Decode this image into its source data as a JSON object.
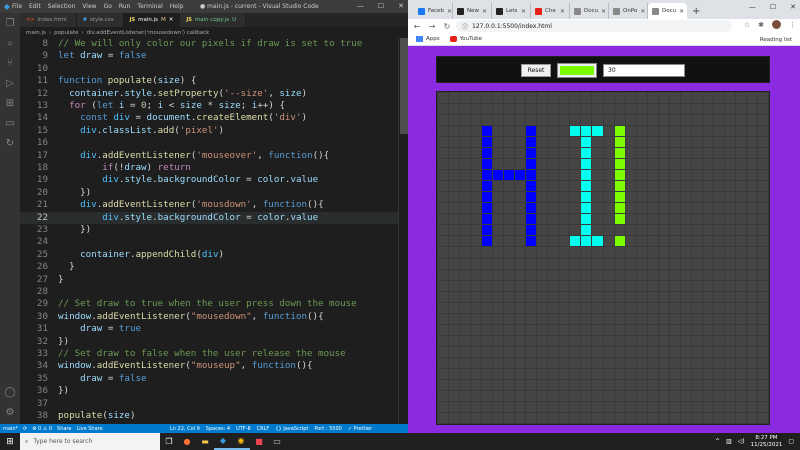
{
  "vscode": {
    "menu": [
      "File",
      "Edit",
      "Selection",
      "View",
      "Go",
      "Run",
      "Terminal",
      "Help"
    ],
    "window_title": "● main.js - current - Visual Studio Code",
    "tabs": [
      {
        "label": "index.html",
        "icon": "<>",
        "color": "#e44d26",
        "active": false,
        "badge": ""
      },
      {
        "label": "style.css",
        "icon": "#",
        "color": "#42a5f5",
        "active": false,
        "badge": ""
      },
      {
        "label": "main.js",
        "icon": "JS",
        "color": "#f1e05a",
        "active": true,
        "badge": "M"
      },
      {
        "label": "main copy.js",
        "icon": "JS",
        "color": "#f1e05a",
        "active": false,
        "badge": "U"
      }
    ],
    "breadcrumb": [
      "main.js",
      "populate",
      "div.addEventListener('mousedown') callback"
    ],
    "current_line": 22,
    "status": {
      "branch": "main*",
      "sync": "⟳",
      "problems": "⊗ 0 ⚠ 0",
      "share": "Share",
      "live_share": "Live Share",
      "position": "Ln 22, Col 9",
      "spaces": "Spaces: 4",
      "encoding": "UTF-8",
      "eol": "CRLF",
      "language": "{} JavaScript",
      "port": "Port : 5500",
      "prettier": "✓ Prettier"
    }
  },
  "code_lines": [
    {
      "n": 8,
      "t": [
        [
          "c",
          "// We will only color our pixels if draw is set to true"
        ]
      ]
    },
    {
      "n": 9,
      "t": [
        [
          "k",
          "let "
        ],
        [
          "v",
          "draw"
        ],
        [
          "p",
          " = "
        ],
        [
          "k",
          "false"
        ]
      ]
    },
    {
      "n": 10,
      "t": []
    },
    {
      "n": 11,
      "t": [
        [
          "k",
          "function "
        ],
        [
          "f",
          "populate"
        ],
        [
          "p",
          "("
        ],
        [
          "v",
          "size"
        ],
        [
          "p",
          ") {"
        ]
      ]
    },
    {
      "n": 12,
      "t": [
        [
          "p",
          "  "
        ],
        [
          "v",
          "container"
        ],
        [
          "p",
          "."
        ],
        [
          "v",
          "style"
        ],
        [
          "p",
          "."
        ],
        [
          "f",
          "setProperty"
        ],
        [
          "p",
          "("
        ],
        [
          "s",
          "'--size'"
        ],
        [
          "p",
          ", "
        ],
        [
          "v",
          "size"
        ],
        [
          "p",
          ")"
        ]
      ]
    },
    {
      "n": 13,
      "t": [
        [
          "kc",
          "  for "
        ],
        [
          "p",
          "("
        ],
        [
          "k",
          "let "
        ],
        [
          "v",
          "i"
        ],
        [
          "p",
          " = "
        ],
        [
          "n",
          "0"
        ],
        [
          "p",
          "; "
        ],
        [
          "v",
          "i"
        ],
        [
          "p",
          " < "
        ],
        [
          "v",
          "size"
        ],
        [
          "p",
          " * "
        ],
        [
          "v",
          "size"
        ],
        [
          "p",
          "; "
        ],
        [
          "v",
          "i"
        ],
        [
          "p",
          "++) {"
        ]
      ]
    },
    {
      "n": 14,
      "t": [
        [
          "k",
          "    const "
        ],
        [
          "o",
          "div"
        ],
        [
          "p",
          " = "
        ],
        [
          "v",
          "document"
        ],
        [
          "p",
          "."
        ],
        [
          "f",
          "createElement"
        ],
        [
          "p",
          "("
        ],
        [
          "s",
          "'div'"
        ],
        [
          "p",
          ")"
        ]
      ]
    },
    {
      "n": 15,
      "t": [
        [
          "p",
          "    "
        ],
        [
          "o",
          "div"
        ],
        [
          "p",
          "."
        ],
        [
          "v",
          "classList"
        ],
        [
          "p",
          "."
        ],
        [
          "f",
          "add"
        ],
        [
          "p",
          "("
        ],
        [
          "s",
          "'pixel'"
        ],
        [
          "p",
          ")"
        ]
      ]
    },
    {
      "n": 16,
      "t": []
    },
    {
      "n": 17,
      "t": [
        [
          "p",
          "    "
        ],
        [
          "o",
          "div"
        ],
        [
          "p",
          "."
        ],
        [
          "f",
          "addEventListener"
        ],
        [
          "p",
          "("
        ],
        [
          "s",
          "'mouseover'"
        ],
        [
          "p",
          ", "
        ],
        [
          "k",
          "function"
        ],
        [
          "p",
          "(){"
        ]
      ]
    },
    {
      "n": 18,
      "t": [
        [
          "kc",
          "        if"
        ],
        [
          "p",
          "(!"
        ],
        [
          "v",
          "draw"
        ],
        [
          "p",
          ") "
        ],
        [
          "kc",
          "return"
        ]
      ]
    },
    {
      "n": 19,
      "t": [
        [
          "p",
          "        "
        ],
        [
          "o",
          "div"
        ],
        [
          "p",
          "."
        ],
        [
          "v",
          "style"
        ],
        [
          "p",
          "."
        ],
        [
          "v",
          "backgroundColor"
        ],
        [
          "p",
          " = "
        ],
        [
          "v",
          "color"
        ],
        [
          "p",
          "."
        ],
        [
          "v",
          "value"
        ]
      ]
    },
    {
      "n": 20,
      "t": [
        [
          "p",
          "    })"
        ]
      ]
    },
    {
      "n": 21,
      "t": [
        [
          "p",
          "    "
        ],
        [
          "o",
          "div"
        ],
        [
          "p",
          "."
        ],
        [
          "f",
          "addEventListener"
        ],
        [
          "p",
          "("
        ],
        [
          "s",
          "'mousdown'"
        ],
        [
          "p",
          ", "
        ],
        [
          "k",
          "function"
        ],
        [
          "p",
          "(){"
        ]
      ]
    },
    {
      "n": 22,
      "t": [
        [
          "p",
          "        "
        ],
        [
          "o",
          "div"
        ],
        [
          "p",
          "."
        ],
        [
          "v",
          "style"
        ],
        [
          "p",
          "."
        ],
        [
          "v",
          "backgroundColor"
        ],
        [
          "p",
          " = "
        ],
        [
          "v",
          "color"
        ],
        [
          "p",
          "."
        ],
        [
          "v",
          "value"
        ]
      ]
    },
    {
      "n": 23,
      "t": [
        [
          "p",
          "    })"
        ]
      ]
    },
    {
      "n": 24,
      "t": []
    },
    {
      "n": 25,
      "t": [
        [
          "p",
          "    "
        ],
        [
          "v",
          "container"
        ],
        [
          "p",
          "."
        ],
        [
          "f",
          "appendChild"
        ],
        [
          "p",
          "("
        ],
        [
          "o",
          "div"
        ],
        [
          "p",
          ")"
        ]
      ]
    },
    {
      "n": 26,
      "t": [
        [
          "p",
          "  }"
        ]
      ]
    },
    {
      "n": 27,
      "t": [
        [
          "p",
          "}"
        ]
      ]
    },
    {
      "n": 28,
      "t": []
    },
    {
      "n": 29,
      "t": [
        [
          "c",
          "// Set draw to true when the user press down the mouse"
        ]
      ]
    },
    {
      "n": 30,
      "t": [
        [
          "v",
          "window"
        ],
        [
          "p",
          "."
        ],
        [
          "f",
          "addEventListener"
        ],
        [
          "p",
          "("
        ],
        [
          "s",
          "\"mousedown\""
        ],
        [
          "p",
          ", "
        ],
        [
          "k",
          "function"
        ],
        [
          "p",
          "(){"
        ]
      ]
    },
    {
      "n": 31,
      "t": [
        [
          "p",
          "    "
        ],
        [
          "v",
          "draw"
        ],
        [
          "p",
          " = "
        ],
        [
          "k",
          "true"
        ]
      ]
    },
    {
      "n": 32,
      "t": [
        [
          "p",
          "})"
        ]
      ]
    },
    {
      "n": 33,
      "t": [
        [
          "c",
          "// Set draw to false when the user release the mouse"
        ]
      ]
    },
    {
      "n": 34,
      "t": [
        [
          "v",
          "window"
        ],
        [
          "p",
          "."
        ],
        [
          "f",
          "addEventListener"
        ],
        [
          "p",
          "("
        ],
        [
          "s",
          "\"mouseup\""
        ],
        [
          "p",
          ", "
        ],
        [
          "k",
          "function"
        ],
        [
          "p",
          "(){"
        ]
      ]
    },
    {
      "n": 35,
      "t": [
        [
          "p",
          "    "
        ],
        [
          "v",
          "draw"
        ],
        [
          "p",
          " = "
        ],
        [
          "k",
          "false"
        ]
      ]
    },
    {
      "n": 36,
      "t": [
        [
          "p",
          "})"
        ]
      ]
    },
    {
      "n": 37,
      "t": []
    },
    {
      "n": 38,
      "t": [
        [
          "f",
          "populate"
        ],
        [
          "p",
          "("
        ],
        [
          "v",
          "size"
        ],
        [
          "p",
          ")"
        ]
      ]
    }
  ],
  "browser": {
    "tabs": [
      {
        "label": "Faceb",
        "color": "#1877f2",
        "active": false
      },
      {
        "label": "New",
        "color": "#222",
        "active": false
      },
      {
        "label": "Lets",
        "color": "#222",
        "active": false
      },
      {
        "label": "Che",
        "color": "#e62117",
        "active": false
      },
      {
        "label": "Docu",
        "color": "#888",
        "active": false
      },
      {
        "label": "OnPo",
        "color": "#888",
        "active": false
      },
      {
        "label": "Docu",
        "color": "#888",
        "active": true
      }
    ],
    "url": "127.0.0.1:5500/index.html",
    "bookmarks": [
      {
        "label": "Apps",
        "color": "#4285f4"
      },
      {
        "label": "YouTube",
        "color": "#e62117"
      }
    ],
    "reading_list": "Reading list"
  },
  "sketch": {
    "reset_label": "Reset",
    "color_value": "#7cfc00",
    "size_value": "30",
    "grid_size": 30,
    "background_color": "#8a2be2",
    "pixel_color": "#454545",
    "painted": [
      {
        "color": "#0000ff",
        "cells": [
          [
            3,
            4
          ],
          [
            4,
            4
          ],
          [
            5,
            4
          ],
          [
            6,
            4
          ],
          [
            7,
            4
          ],
          [
            8,
            4
          ],
          [
            9,
            4
          ],
          [
            10,
            4
          ],
          [
            11,
            4
          ],
          [
            12,
            4
          ],
          [
            13,
            4
          ],
          [
            3,
            8
          ],
          [
            4,
            8
          ],
          [
            5,
            8
          ],
          [
            6,
            8
          ],
          [
            7,
            8
          ],
          [
            8,
            8
          ],
          [
            9,
            8
          ],
          [
            10,
            8
          ],
          [
            11,
            8
          ],
          [
            12,
            8
          ],
          [
            13,
            8
          ],
          [
            7,
            5
          ],
          [
            7,
            6
          ],
          [
            7,
            7
          ]
        ]
      },
      {
        "color": "#00ffee",
        "cells": [
          [
            3,
            12
          ],
          [
            3,
            13
          ],
          [
            3,
            14
          ],
          [
            13,
            12
          ],
          [
            13,
            13
          ],
          [
            13,
            14
          ],
          [
            4,
            13
          ],
          [
            5,
            13
          ],
          [
            6,
            13
          ],
          [
            7,
            13
          ],
          [
            8,
            13
          ],
          [
            9,
            13
          ],
          [
            10,
            13
          ],
          [
            11,
            13
          ],
          [
            12,
            13
          ]
        ]
      },
      {
        "color": "#7cfc00",
        "cells": [
          [
            3,
            16
          ],
          [
            4,
            16
          ],
          [
            5,
            16
          ],
          [
            6,
            16
          ],
          [
            7,
            16
          ],
          [
            8,
            16
          ],
          [
            9,
            16
          ],
          [
            10,
            16
          ],
          [
            11,
            16
          ],
          [
            13,
            16
          ]
        ]
      }
    ]
  },
  "taskbar": {
    "search_placeholder": "Type here to search",
    "time": "8:27 PM",
    "date": "11/25/2021"
  }
}
